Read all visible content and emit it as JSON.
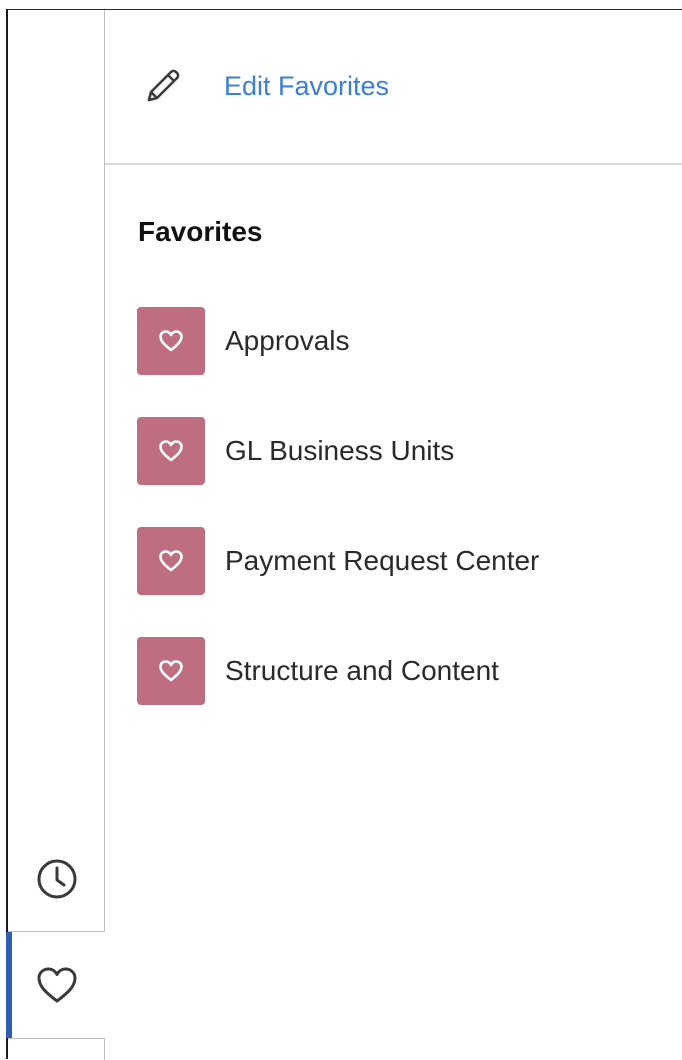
{
  "header": {
    "edit_link_label": "Edit Favorites",
    "edit_icon": "pencil-icon"
  },
  "favorites": {
    "heading": "Favorites",
    "item_icon": "heart-icon",
    "tile_color": "#bf6d80",
    "items": [
      {
        "label": "Approvals"
      },
      {
        "label": "GL Business Units"
      },
      {
        "label": "Payment Request Center"
      },
      {
        "label": "Structure and Content"
      }
    ]
  },
  "rail": {
    "tabs": [
      {
        "icon": "clock-icon",
        "active": false
      },
      {
        "icon": "heart-icon",
        "active": true
      }
    ],
    "active_color": "#2f5fb3"
  },
  "colors": {
    "link": "#3b7fd4",
    "divider": "#d5d9de"
  }
}
